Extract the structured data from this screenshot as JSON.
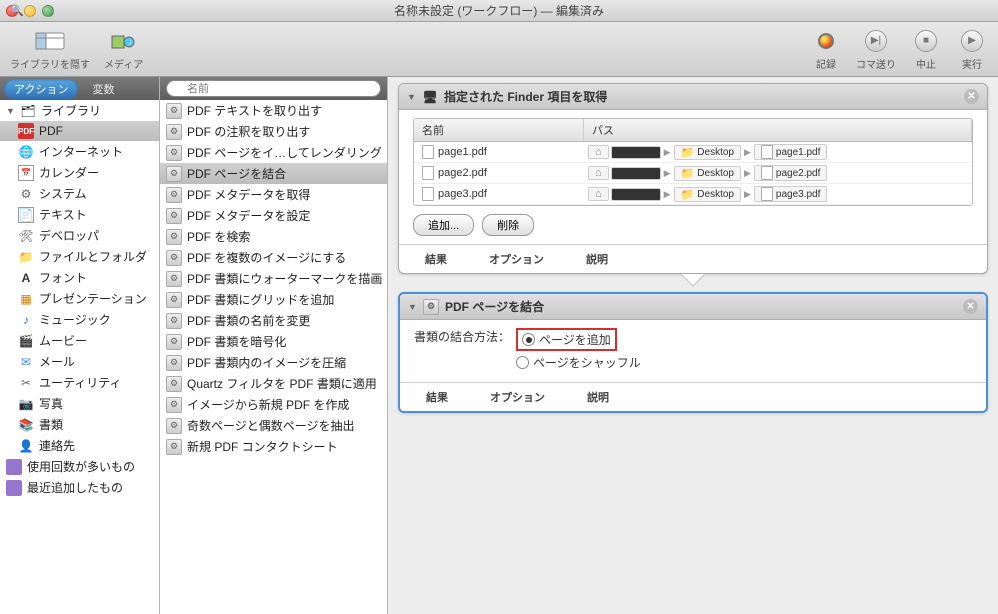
{
  "window": {
    "title": "名称未設定 (ワークフロー) — 編集済み"
  },
  "toolbar": {
    "hide_library": "ライブラリを隠す",
    "media": "メディア",
    "record": "記録",
    "step": "コマ送り",
    "stop": "中止",
    "run": "実行"
  },
  "tabs": {
    "actions": "アクション",
    "variables": "変数"
  },
  "search": {
    "placeholder": "名前"
  },
  "library": {
    "root": "ライブラリ",
    "items": [
      "PDF",
      "インターネット",
      "カレンダー",
      "システム",
      "テキスト",
      "デベロッパ",
      "ファイルとフォルダ",
      "フォント",
      "プレゼンテーション",
      "ミュージック",
      "ムービー",
      "メール",
      "ユーティリティ",
      "写真",
      "書類",
      "連絡先"
    ],
    "smart": [
      "使用回数が多いもの",
      "最近追加したもの"
    ]
  },
  "actions": [
    "PDF テキストを取り出す",
    "PDF の注釈を取り出す",
    "PDF ページをイ…してレンダリング",
    "PDF ページを結合",
    "PDF メタデータを取得",
    "PDF メタデータを設定",
    "PDF を検索",
    "PDF を複数のイメージにする",
    "PDF 書類にウォーターマークを描画",
    "PDF 書類にグリッドを追加",
    "PDF 書類の名前を変更",
    "PDF 書類を暗号化",
    "PDF 書類内のイメージを圧縮",
    "Quartz フィルタを PDF 書類に適用",
    "イメージから新規 PDF を作成",
    "奇数ページと偶数ページを抽出",
    "新規 PDF コンタクトシート"
  ],
  "actions_selected_index": 3,
  "step1": {
    "title": "指定された Finder 項目を取得",
    "cols": {
      "name": "名前",
      "path": "パス"
    },
    "rows": [
      {
        "name": "page1.pdf",
        "desktop": "Desktop",
        "file": "page1.pdf"
      },
      {
        "name": "page2.pdf",
        "desktop": "Desktop",
        "file": "page2.pdf"
      },
      {
        "name": "page3.pdf",
        "desktop": "Desktop",
        "file": "page3.pdf"
      }
    ],
    "add": "追加...",
    "remove": "削除"
  },
  "step2": {
    "title": "PDF ページを結合",
    "label": "書類の結合方法：",
    "opt_append": "ページを追加",
    "opt_shuffle": "ページをシャッフル"
  },
  "footer": {
    "results": "結果",
    "options": "オプション",
    "desc": "説明"
  }
}
